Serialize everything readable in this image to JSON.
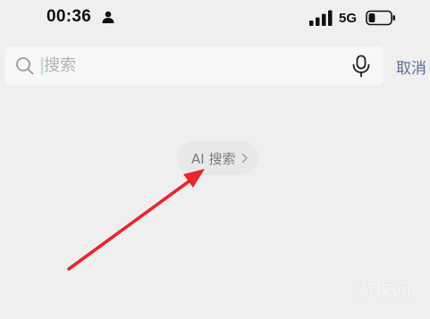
{
  "status_bar": {
    "time": "00:36",
    "network": "5G",
    "battery_level": 0.3,
    "icons": [
      "person-icon",
      "signal-icon",
      "battery-icon"
    ]
  },
  "search": {
    "placeholder": "搜索",
    "value": "",
    "cancel_label": "取消",
    "icons": [
      "search-icon",
      "microphone-icon"
    ]
  },
  "ai_search": {
    "label": "AI 搜索",
    "icon": "chevron-right-icon"
  },
  "annotation": {
    "color": "#e8262d",
    "icon": "red-arrow"
  },
  "watermark": {
    "text": "游侠网"
  }
}
